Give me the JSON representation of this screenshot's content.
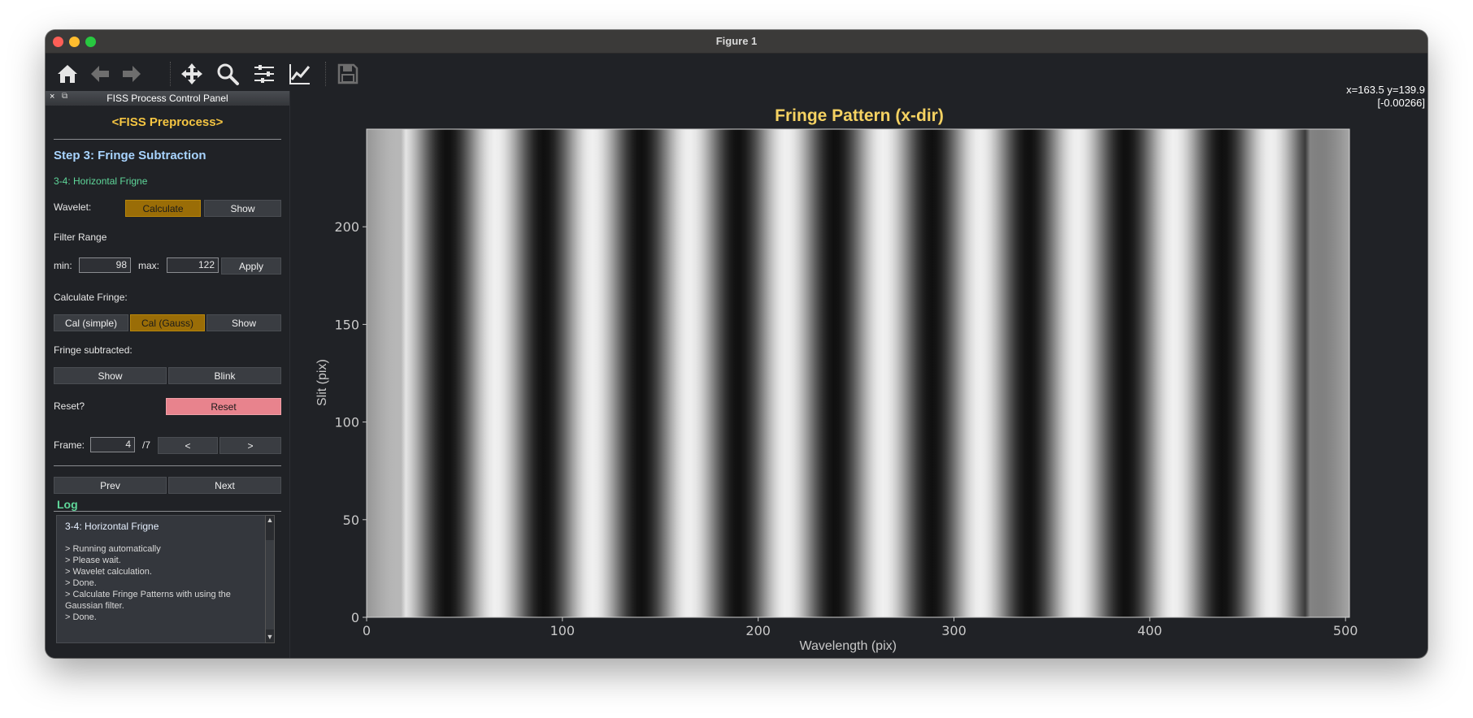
{
  "window": {
    "title": "Figure 1"
  },
  "toolbar": {
    "icons": [
      "home-icon",
      "back-icon",
      "forward-icon",
      "pan-icon",
      "zoom-icon",
      "configure-subplots-icon",
      "edit-axis-icon",
      "save-icon"
    ],
    "coord_line1": "x=163.5 y=139.9",
    "coord_line2": "[-0.00266]"
  },
  "panel": {
    "header_close": "×",
    "header_float": "⧉",
    "header_title": "FISS Process Control Panel",
    "preprocess_title": "<FISS Preprocess>",
    "step_title": "Step 3: Fringe Subtraction",
    "substep": "3-4: Horizontal Frigne",
    "wavelet_label": "Wavelet:",
    "wavelet_calculate": "Calculate",
    "wavelet_show": "Show",
    "filter_range_label": "Filter Range",
    "min_label": "min:",
    "min_value": "98",
    "max_label": "max:",
    "max_value": "122",
    "apply_label": "Apply",
    "calc_fringe_label": "Calculate Fringe:",
    "cal_simple": "Cal (simple)",
    "cal_gauss": "Cal (Gauss)",
    "fringe_show": "Show",
    "fringe_subtracted_label": "Fringe subtracted:",
    "sub_show": "Show",
    "sub_blink": "Blink",
    "reset_label": "Reset?",
    "reset_button": "Reset",
    "frame_label": "Frame:",
    "frame_value": "4",
    "frame_total": "/7",
    "frame_prev": "<",
    "frame_next": ">",
    "prev_button": "Prev",
    "next_button": "Next",
    "log_title": "Log",
    "log_header": "3-4: Horizontal Frigne",
    "log_lines": [
      "> Running automatically",
      "> Please wait.",
      "> Wavelet calculation.",
      "> Done.",
      "> Calculate Fringe Patterns with using the",
      "Gaussian filter.",
      "> Done."
    ]
  },
  "chart_data": {
    "type": "heatmap",
    "title": "Fringe Pattern (x-dir)",
    "xlabel": "Wavelength (pix)",
    "ylabel": "Slit (pix)",
    "xlim": [
      0,
      502
    ],
    "ylim": [
      0,
      250
    ],
    "xticks": [
      0,
      100,
      200,
      300,
      400,
      500
    ],
    "yticks": [
      0,
      50,
      100,
      150,
      200
    ],
    "colormap": "gray",
    "fringe_period_pix": 49.5,
    "colors": {
      "title": "#f5d262",
      "axis_text": "#c8c8c8",
      "background": "#202226"
    }
  }
}
